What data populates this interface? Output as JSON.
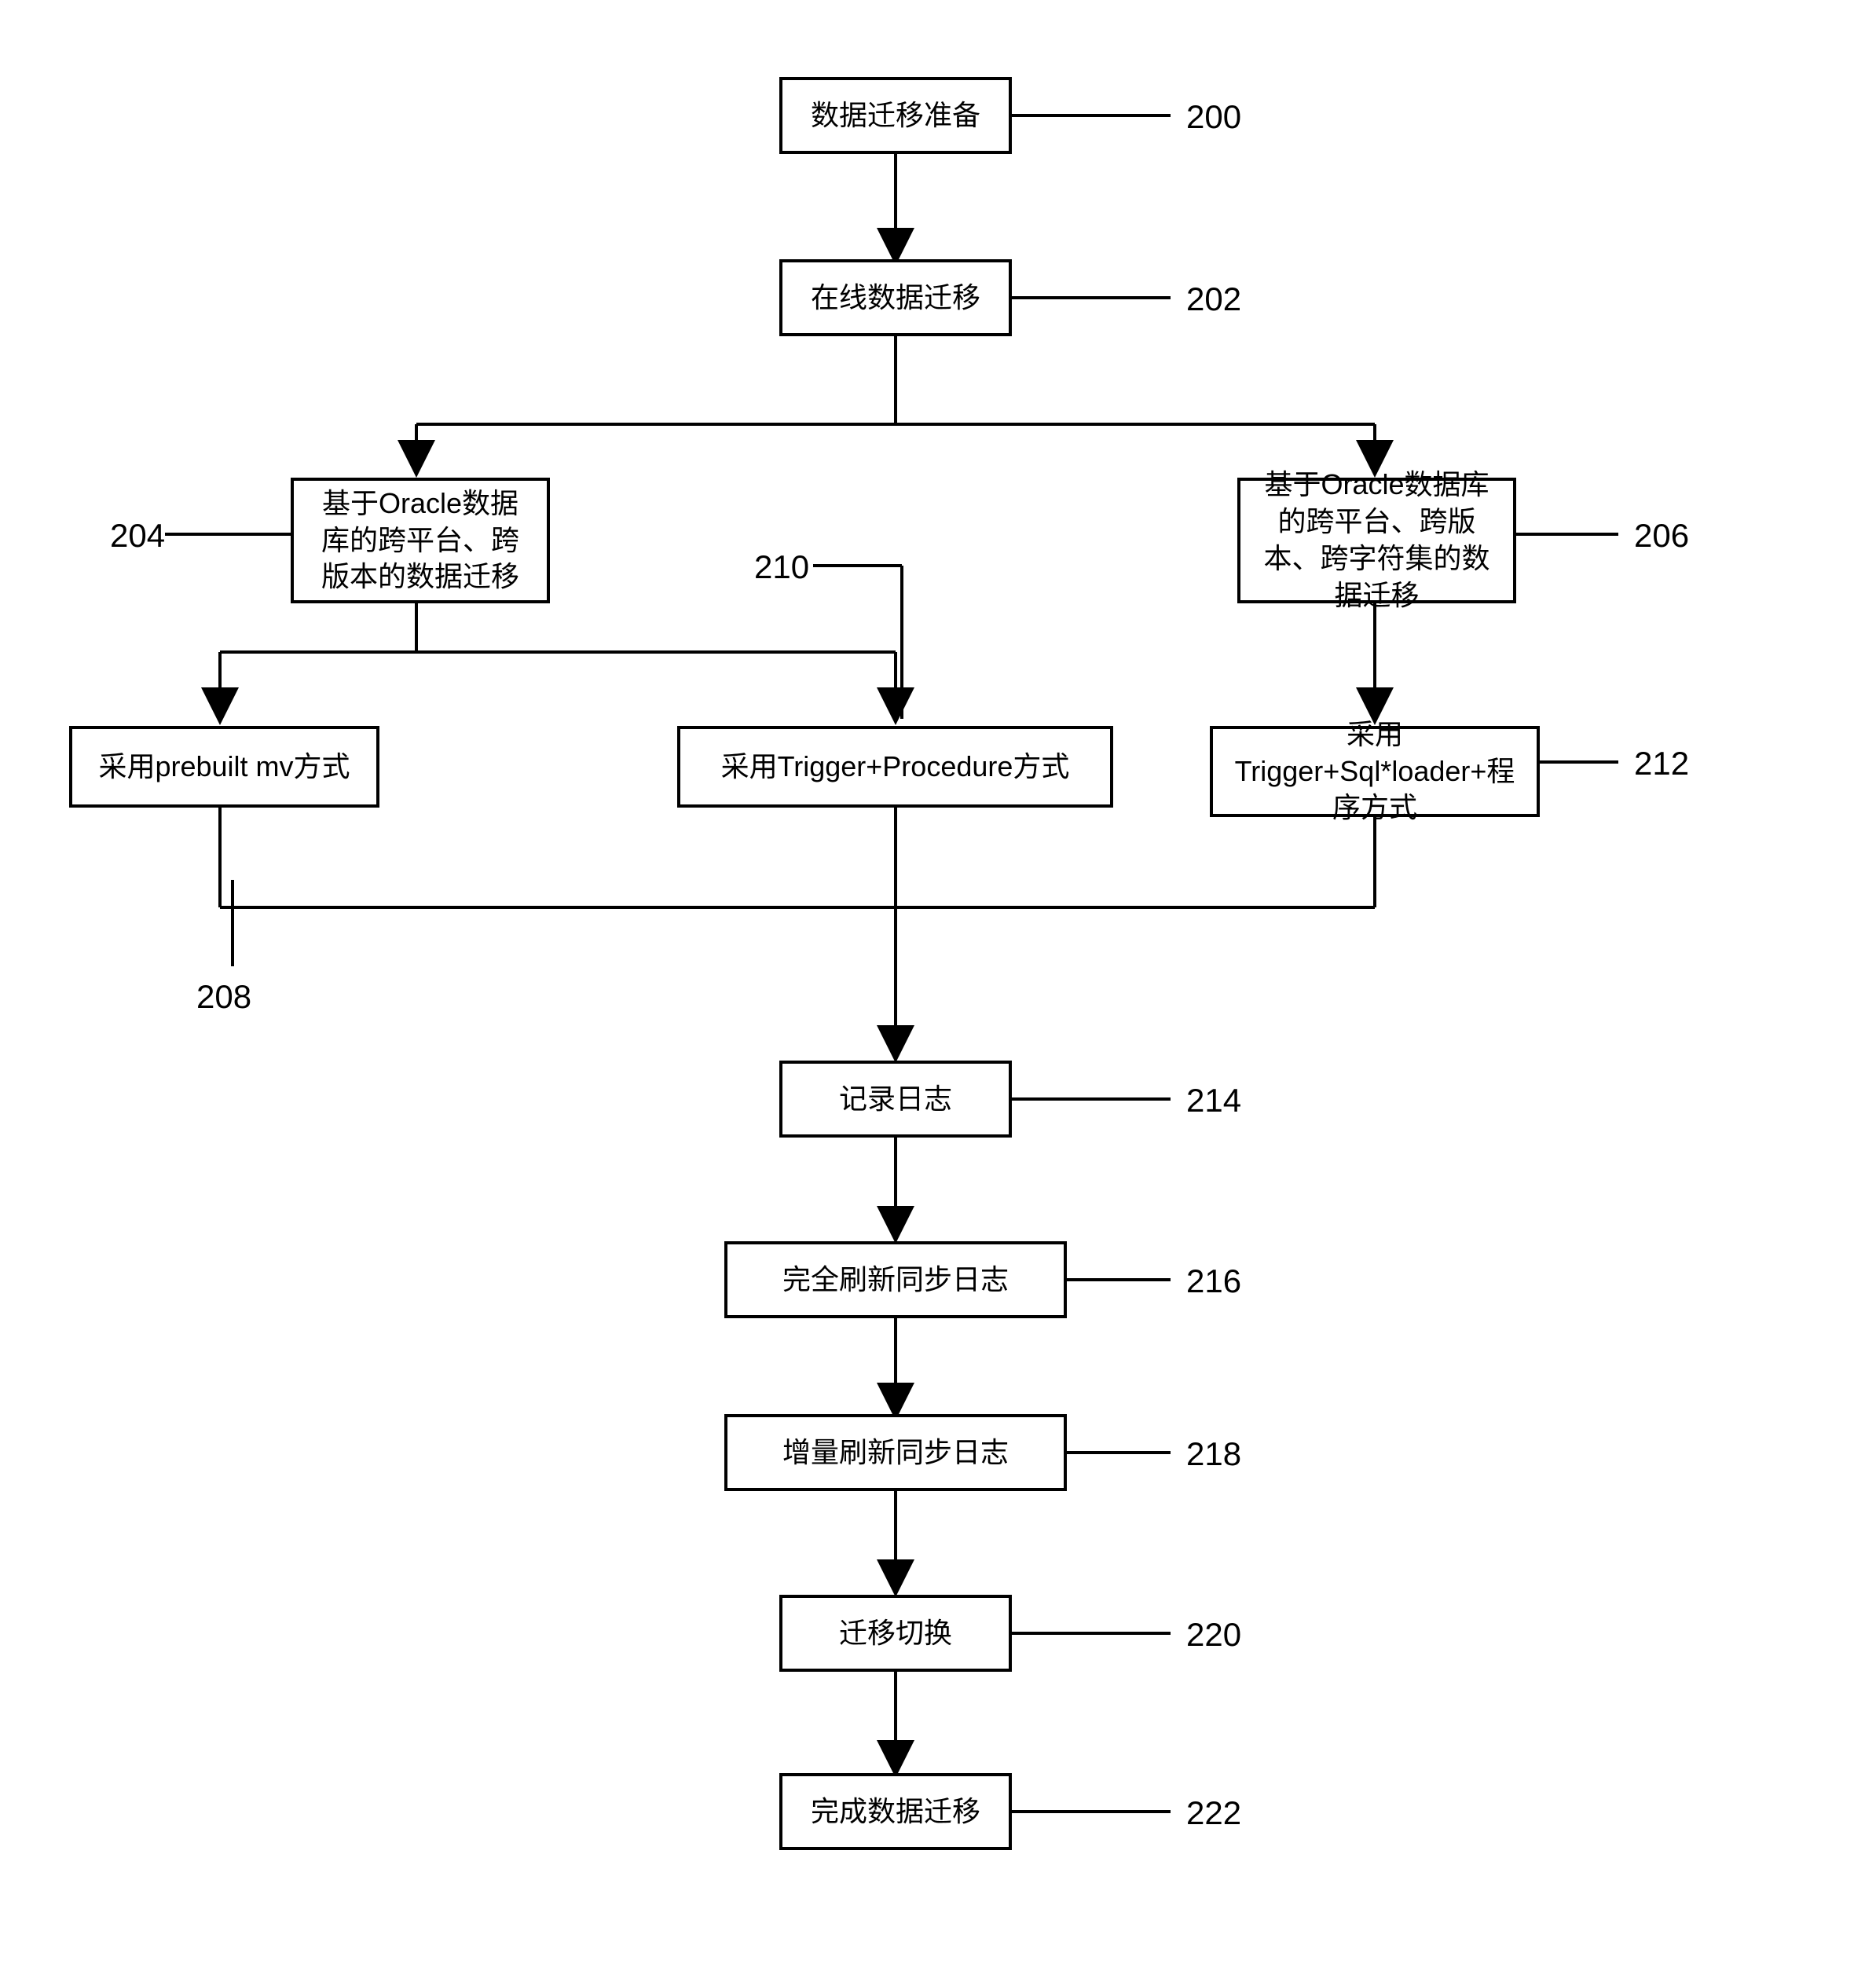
{
  "nodes": {
    "200": {
      "text": "数据迁移准备",
      "label": "200"
    },
    "202": {
      "text": "在线数据迁移",
      "label": "202"
    },
    "204": {
      "text": "基于Oracle数据库的跨平台、跨版本的数据迁移",
      "label": "204"
    },
    "206": {
      "text": "基于Oracle数据库的跨平台、跨版本、跨字符集的数据迁移",
      "label": "206"
    },
    "208": {
      "text": "采用prebuilt mv方式",
      "label": "208"
    },
    "210": {
      "text": "采用Trigger+Procedure方式",
      "label": "210"
    },
    "212": {
      "text": "采用Trigger+Sql*loader+程序方式",
      "label": "212"
    },
    "214": {
      "text": "记录日志",
      "label": "214"
    },
    "216": {
      "text": "完全刷新同步日志",
      "label": "216"
    },
    "218": {
      "text": "增量刷新同步日志",
      "label": "218"
    },
    "220": {
      "text": "迁移切换",
      "label": "220"
    },
    "222": {
      "text": "完成数据迁移",
      "label": "222"
    }
  }
}
